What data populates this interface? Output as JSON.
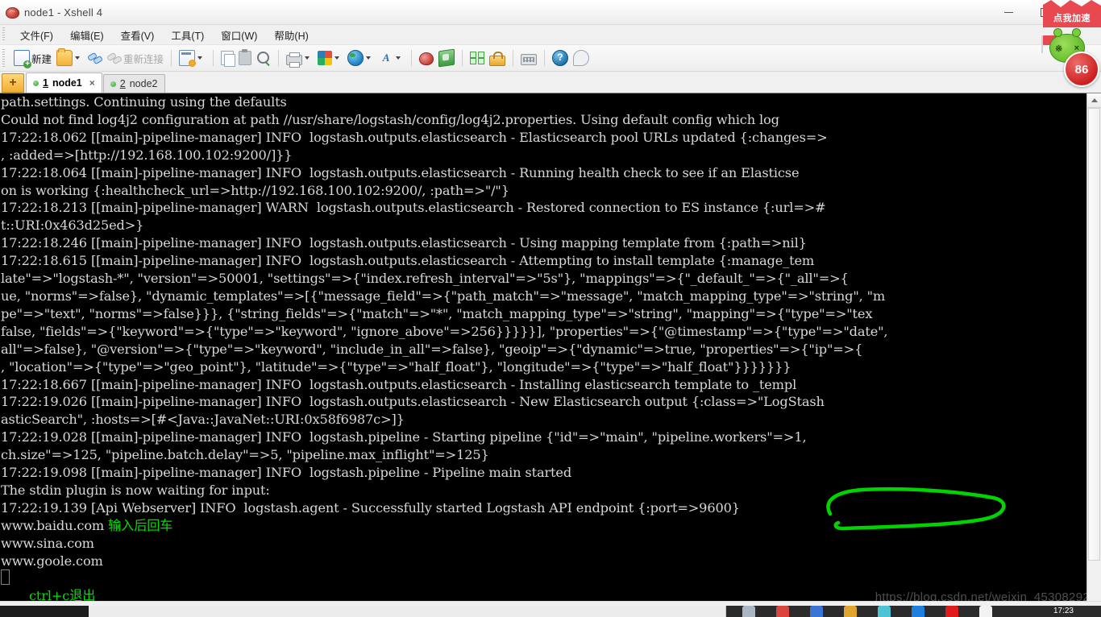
{
  "window": {
    "title": "node1 - Xshell 4",
    "icon": "xshell-logo-icon",
    "minimize_label": "—",
    "maximize_label": "❐",
    "close_label": "✕"
  },
  "menu": {
    "items": [
      {
        "label": "文件(F)",
        "name": "menu-file"
      },
      {
        "label": "编辑(E)",
        "name": "menu-edit"
      },
      {
        "label": "查看(V)",
        "name": "menu-view"
      },
      {
        "label": "工具(T)",
        "name": "menu-tools"
      },
      {
        "label": "窗口(W)",
        "name": "menu-window"
      },
      {
        "label": "帮助(H)",
        "name": "menu-help"
      }
    ]
  },
  "toolbar": {
    "new_label": "新建",
    "reconnect_label": "重新连接",
    "help_glyph": "?",
    "new_tab_glyph": "+"
  },
  "tabs": [
    {
      "num": "1",
      "label": "node1",
      "active": true,
      "close_label": "×"
    },
    {
      "num": "2",
      "label": "node2",
      "active": false,
      "close_label": ""
    }
  ],
  "terminal": {
    "lines": [
      "path.settings. Continuing using the defaults",
      "Could not find log4j2 configuration at path //usr/share/logstash/config/log4j2.properties. Using default config which log",
      "17:22:18.062 [[main]-pipeline-manager] INFO  logstash.outputs.elasticsearch - Elasticsearch pool URLs updated {:changes=>",
      ", :added=>[http://192.168.100.102:9200/]}}",
      "17:22:18.064 [[main]-pipeline-manager] INFO  logstash.outputs.elasticsearch - Running health check to see if an Elasticse",
      "on is working {:healthcheck_url=>http://192.168.100.102:9200/, :path=>\"/\"}",
      "17:22:18.213 [[main]-pipeline-manager] WARN  logstash.outputs.elasticsearch - Restored connection to ES instance {:url=>#",
      "t::URI:0x463d25ed>}",
      "17:22:18.246 [[main]-pipeline-manager] INFO  logstash.outputs.elasticsearch - Using mapping template from {:path=>nil}",
      "17:22:18.615 [[main]-pipeline-manager] INFO  logstash.outputs.elasticsearch - Attempting to install template {:manage_tem",
      "late\"=>\"logstash-*\", \"version\"=>50001, \"settings\"=>{\"index.refresh_interval\"=>\"5s\"}, \"mappings\"=>{\"_default_\"=>{\"_all\"=>{",
      "ue, \"norms\"=>false}, \"dynamic_templates\"=>[{\"message_field\"=>{\"path_match\"=>\"message\", \"match_mapping_type\"=>\"string\", \"m",
      "pe\"=>\"text\", \"norms\"=>false}}}, {\"string_fields\"=>{\"match\"=>\"*\", \"match_mapping_type\"=>\"string\", \"mapping\"=>{\"type\"=>\"tex",
      "false, \"fields\"=>{\"keyword\"=>{\"type\"=>\"keyword\", \"ignore_above\"=>256}}}}}], \"properties\"=>{\"@timestamp\"=>{\"type\"=>\"date\",",
      "all\"=>false}, \"@version\"=>{\"type\"=>\"keyword\", \"include_in_all\"=>false}, \"geoip\"=>{\"dynamic\"=>true, \"properties\"=>{\"ip\"=>{",
      ", \"location\"=>{\"type\"=>\"geo_point\"}, \"latitude\"=>{\"type\"=>\"half_float\"}, \"longitude\"=>{\"type\"=>\"half_float\"}}}}}}}",
      "17:22:18.667 [[main]-pipeline-manager] INFO  logstash.outputs.elasticsearch - Installing elasticsearch template to _templ",
      "17:22:19.026 [[main]-pipeline-manager] INFO  logstash.outputs.elasticsearch - New Elasticsearch output {:class=>\"LogStash",
      "asticSearch\", :hosts=>[#<Java::JavaNet::URI:0x58f6987c>]}",
      "17:22:19.028 [[main]-pipeline-manager] INFO  logstash.pipeline - Starting pipeline {\"id\"=>\"main\", \"pipeline.workers\"=>1,",
      "ch.size\"=>125, \"pipeline.batch.delay\"=>5, \"pipeline.max_inflight\"=>125}",
      "17:22:19.098 [[main]-pipeline-manager] INFO  logstash.pipeline - Pipeline main started",
      "The stdin plugin is now waiting for input:"
    ],
    "endpoint_line_prefix": "17:22:19.139 [Api Webserver] INFO  logstash.agent - Successfully started Logstash API endpoint ",
    "endpoint_circled": "{:port=>9600}",
    "input_lines": [
      {
        "text": "www.baidu.com",
        "annotation": "输入后回车"
      },
      {
        "text": "www.sina.com",
        "annotation": ""
      },
      {
        "text": "www.goole.com",
        "annotation": ""
      }
    ],
    "exit_annotation": "ctrl+c退出",
    "text_color": "#d8d8d8",
    "annotation_color": "#00e000",
    "background_color": "#000000"
  },
  "statusbar": {
    "text": ""
  },
  "taskbar": {
    "clock": "17:23"
  },
  "watermark": {
    "text": "https://blog.csdn.net/weixin_45308292"
  },
  "accelerate_widget": {
    "banner_text": "点我加速",
    "badge_value": "86",
    "left_eye": "※",
    "right_eye": "×"
  }
}
